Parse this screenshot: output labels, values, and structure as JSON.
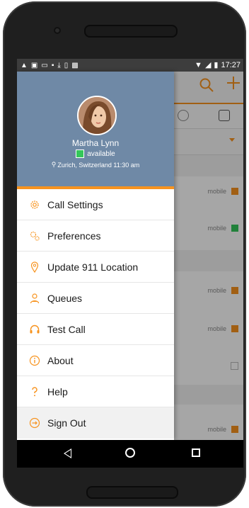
{
  "status_bar": {
    "left_icons": [
      "warning-icon",
      "voicemail-icon",
      "image-icon",
      "message-icon",
      "download-icon",
      "sim-icon",
      "photo-icon"
    ],
    "time": "17:27"
  },
  "profile": {
    "name": "Martha Lynn",
    "status": "available",
    "location": "Zurich, Switzerland  11:30 am",
    "status_color": "#34c759"
  },
  "menu": {
    "items": [
      {
        "label": "Call Settings",
        "icon": "gear-icon"
      },
      {
        "label": "Preferences",
        "icon": "preferences-icon"
      },
      {
        "label": "Update 911 Location",
        "icon": "location-pin-icon"
      },
      {
        "label": "Queues",
        "icon": "queues-icon"
      },
      {
        "label": "Test Call",
        "icon": "headset-icon"
      },
      {
        "label": "About",
        "icon": "info-icon"
      },
      {
        "label": "Help",
        "icon": "question-icon"
      },
      {
        "label": "Sign Out",
        "icon": "sign-out-icon"
      }
    ]
  },
  "background_list": {
    "rows": [
      {
        "label": "mobile",
        "badge_color": "#f7931e"
      },
      {
        "label": "mobile",
        "badge_color": "#34c759"
      },
      {
        "label": "mobile",
        "badge_color": "#f7931e"
      },
      {
        "label": "mobile",
        "badge_color": "#f7931e"
      },
      {
        "label": "mobile",
        "badge_color": "#f7931e"
      }
    ]
  },
  "colors": {
    "accent": "#f7931e",
    "header_bg": "#6f89a6"
  }
}
